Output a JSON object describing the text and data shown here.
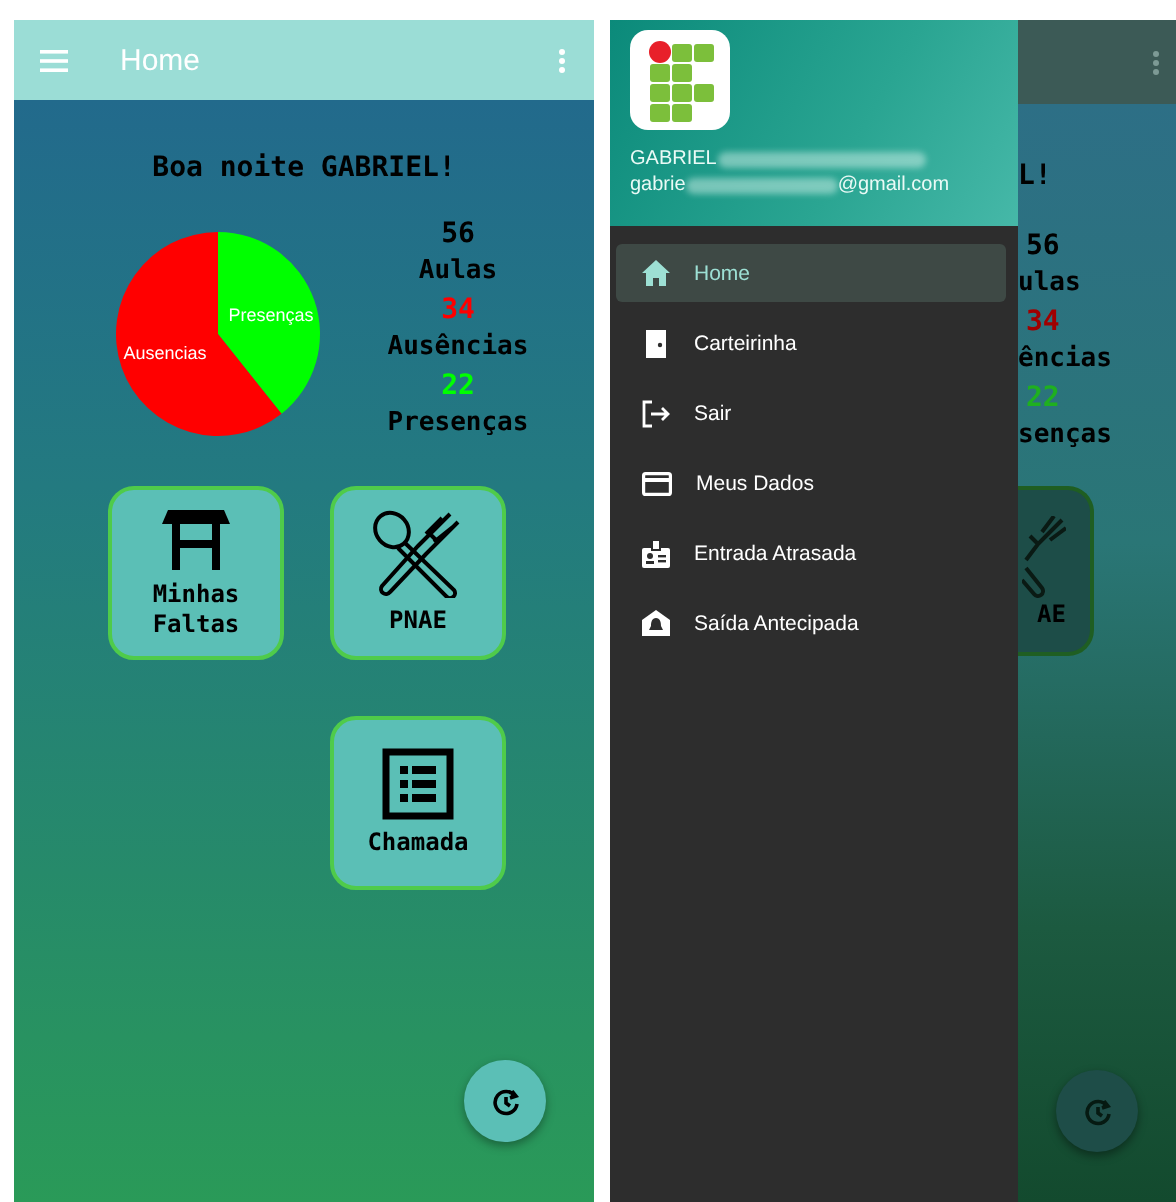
{
  "home_screen": {
    "app_bar": {
      "title": "Home"
    },
    "greeting": "Boa noite GABRIEL!",
    "chart_data": {
      "type": "pie",
      "categories": [
        "Ausencias",
        "Presenças"
      ],
      "values": [
        60.7,
        39.3
      ],
      "colors": [
        "#ff0000",
        "#00ff00"
      ]
    },
    "stats": [
      {
        "value": "56",
        "label": "Aulas",
        "color": "#000000"
      },
      {
        "value": "34",
        "label": "Ausências",
        "color": "#ff0000"
      },
      {
        "value": "22",
        "label": "Presenças",
        "color": "#00ff00"
      }
    ],
    "tiles": [
      {
        "label": "Minhas Faltas"
      },
      {
        "label": "PNAE"
      },
      {
        "label": "Chamada"
      }
    ]
  },
  "drawer_screen": {
    "header": {
      "name": "GABRIEL",
      "email_start": "gabrie",
      "email_end": "@gmail.com"
    },
    "menu": [
      {
        "label": "Home",
        "selected": true
      },
      {
        "label": "Carteirinha",
        "selected": false
      },
      {
        "label": "Sair",
        "selected": false
      },
      {
        "label": "Meus Dados",
        "selected": false
      },
      {
        "label": "Entrada Atrasada",
        "selected": false
      },
      {
        "label": "Saída Antecipada",
        "selected": false
      }
    ],
    "behind_drawer": {
      "greeting": "L!",
      "stats": [
        {
          "value": "56",
          "label": "ulas",
          "color": "#000000"
        },
        {
          "value": "34",
          "label": "ências",
          "color": "#a00000"
        },
        {
          "value": "22",
          "label": "senças",
          "color": "#1fb01f"
        }
      ],
      "tile_label": "AE"
    }
  }
}
